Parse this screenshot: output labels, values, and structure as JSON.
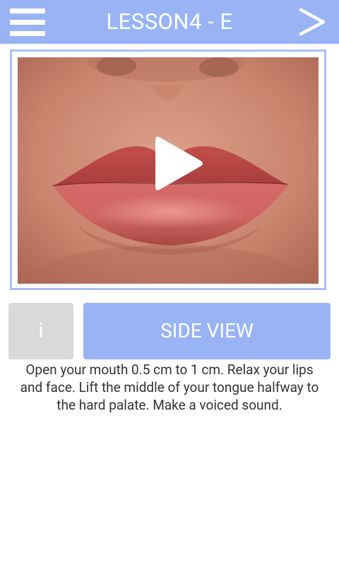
{
  "header": {
    "title": "LESSON4 - E",
    "menu_icon": "hamburger-menu-icon",
    "next_icon": "chevron-right-icon"
  },
  "video": {
    "play_icon": "play-icon"
  },
  "buttons": {
    "info_label": "i",
    "side_view_label": "SIDE VIEW"
  },
  "instructions": {
    "text": "Open your mouth 0.5 cm to 1 cm. Relax your lips and face. Lift the middle of your tongue halfway to the hard palate. Make a voiced sound."
  },
  "colors": {
    "accent": "#98b4f5",
    "frame_border": "#a8c0f3",
    "info_button": "#d9d9d9",
    "text": "#333333"
  }
}
